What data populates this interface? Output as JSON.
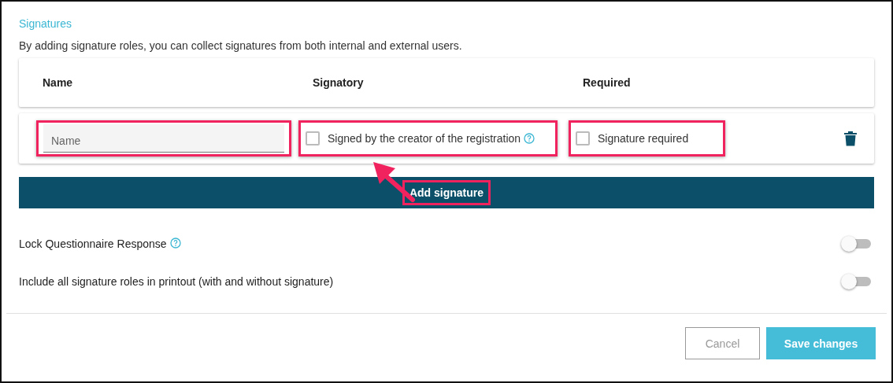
{
  "section": {
    "title": "Signatures",
    "description": "By adding signature roles, you can collect signatures from both internal and external users."
  },
  "table": {
    "columns": [
      "Name",
      "Signatory",
      "Required"
    ],
    "rows": [
      {
        "name_field": {
          "placeholder": "Name"
        },
        "signatory": {
          "label": "Signed by the creator of the registration",
          "checked": false
        },
        "required": {
          "label": "Signature required",
          "checked": false
        }
      }
    ]
  },
  "add_button": "Add signature",
  "toggles": [
    {
      "label": "Lock Questionnaire Response",
      "help": true,
      "on": false
    },
    {
      "label": "Include all signature roles in printout (with and without signature)",
      "help": false,
      "on": false
    }
  ],
  "footer": {
    "buttons": [
      {
        "label": "Cancel",
        "kind": "secondary"
      },
      {
        "label": "Save changes",
        "kind": "primary"
      }
    ]
  }
}
